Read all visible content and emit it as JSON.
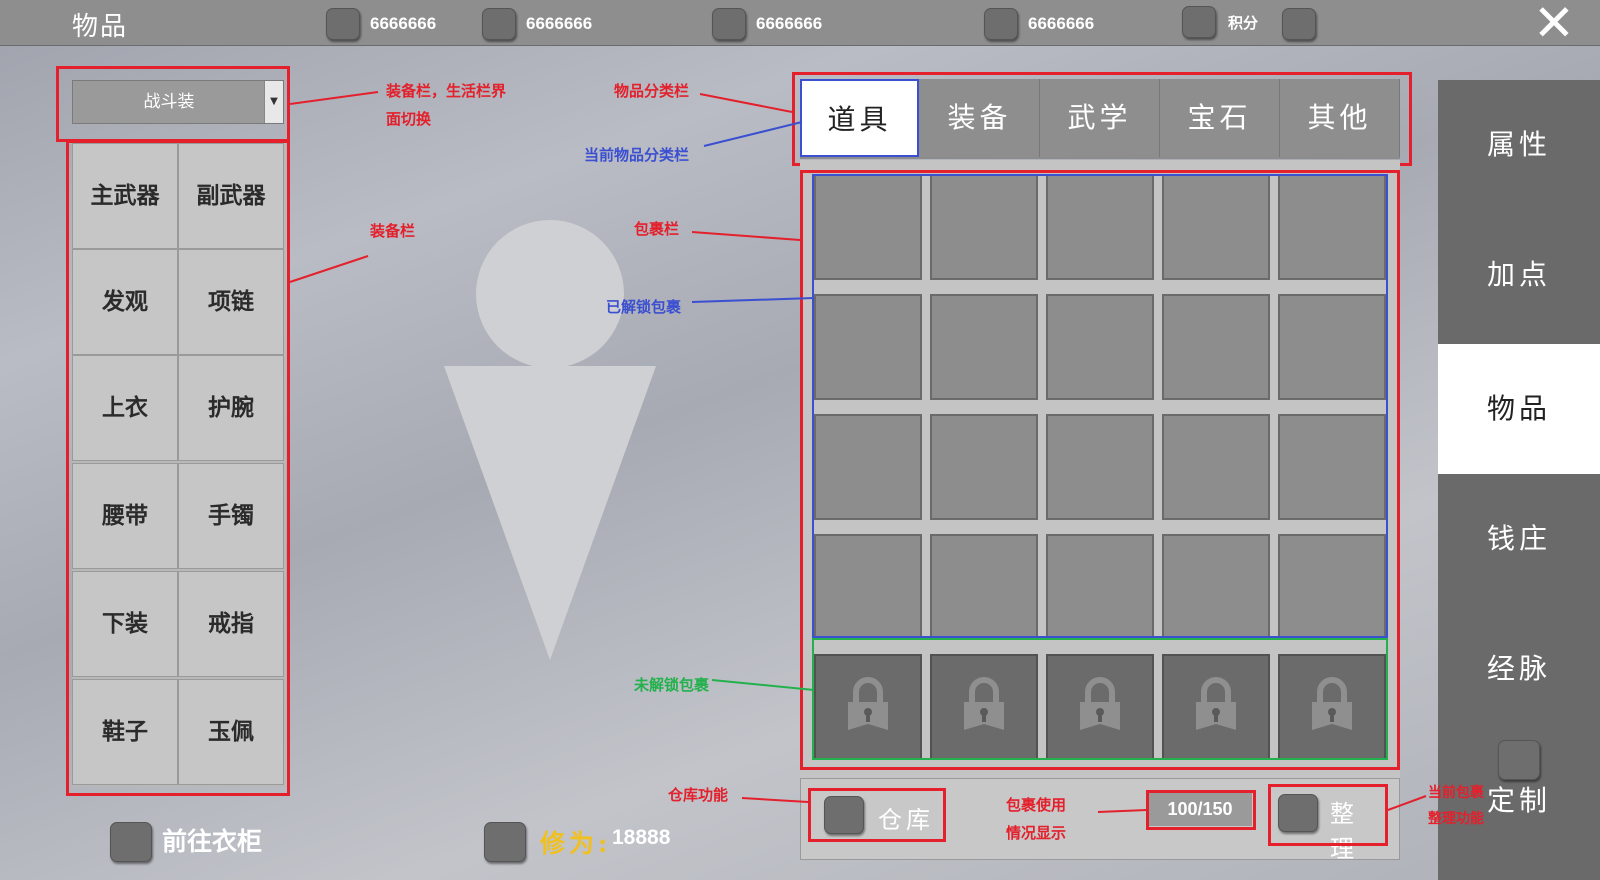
{
  "header": {
    "title": "物品",
    "currencies": [
      {
        "icon": "currency-icon",
        "value": "6666666"
      },
      {
        "icon": "currency-icon",
        "value": "6666666"
      },
      {
        "icon": "currency-icon",
        "value": "6666666"
      },
      {
        "icon": "currency-icon",
        "value": "6666666"
      },
      {
        "icon": "points-icon",
        "value": "积分"
      }
    ],
    "close_icon": "close-icon"
  },
  "sidebar": {
    "tabs": [
      {
        "label": "属性",
        "active": false
      },
      {
        "label": "加点",
        "active": false
      },
      {
        "label": "物品",
        "active": true
      },
      {
        "label": "钱庄",
        "active": false
      },
      {
        "label": "经脉",
        "active": false
      },
      {
        "label": "定制",
        "active": false
      }
    ]
  },
  "equipment": {
    "dropdown_value": "战斗装",
    "slots": [
      [
        "主武器",
        "副武器"
      ],
      [
        "发观",
        "项链"
      ],
      [
        "上衣",
        "护腕"
      ],
      [
        "腰带",
        "手镯"
      ],
      [
        "下装",
        "戒指"
      ],
      [
        "鞋子",
        "玉佩"
      ]
    ],
    "wardrobe_label": "前往衣柜",
    "cultivation_label": "修为:",
    "cultivation_value": "18888"
  },
  "inventory": {
    "categories": [
      {
        "label": "道具",
        "active": true
      },
      {
        "label": "装备",
        "active": false
      },
      {
        "label": "武学",
        "active": false
      },
      {
        "label": "宝石",
        "active": false
      },
      {
        "label": "其他",
        "active": false
      }
    ],
    "unlocked_rows": 4,
    "locked_rows": 1,
    "columns": 5,
    "warehouse_label": "仓库",
    "capacity": "100/150",
    "sort_label": "整理"
  },
  "annotations": {
    "dropdown_note_1": "装备栏，生活栏界",
    "dropdown_note_2": "面切换",
    "equip_note": "装备栏",
    "category_note": "物品分类栏",
    "current_category_note": "当前物品分类栏",
    "bag_note": "包裹栏",
    "unlocked_note": "已解锁包裹",
    "locked_note": "未解锁包裹",
    "warehouse_note": "仓库功能",
    "capacity_note_1": "包裹使用",
    "capacity_note_2": "情况显示",
    "sort_note_1": "当前包裹",
    "sort_note_2": "整理功能"
  },
  "colors": {
    "annotation_red": "#e3202b",
    "annotation_blue": "#3b4fd1",
    "annotation_green": "#22b14c",
    "cultivation_gold": "#f0c020"
  }
}
